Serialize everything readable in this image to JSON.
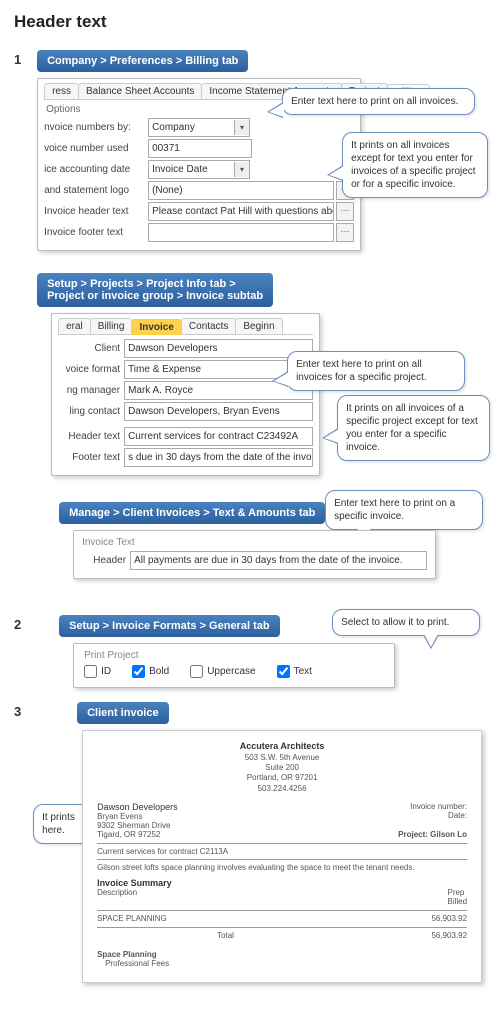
{
  "title": "Header text",
  "steps": [
    "1",
    "2",
    "3"
  ],
  "bc": {
    "billing": "Company > Preferences > Billing  tab",
    "project": "Setup > Projects > Project Info tab >\nProject or invoice group > Invoice subtab",
    "manage": "Manage > Client Invoices > Text & Amounts tab",
    "formats": "Setup > Invoice Formats > General tab",
    "client": "Client invoice"
  },
  "billing": {
    "tabs": [
      "ress",
      "Balance Sheet Accounts",
      "Income Statement Accounts",
      "Project",
      "Billing"
    ],
    "options": "Options",
    "labels": {
      "numby": "nvoice numbers by:",
      "numused": "voice number used",
      "acct": "ice accounting date",
      "logo": "and statement logo",
      "header": "Invoice header text",
      "footer": "Invoice footer text"
    },
    "vals": {
      "numby": "Company",
      "numused": "00371",
      "acct": "Invoice Date",
      "logo": "(None)",
      "header": "Please contact Pat Hill with questions about this invoice.",
      "footer": ""
    }
  },
  "callouts": {
    "c1": "Enter text here to print on all invoices.",
    "c1b": "It prints on all invoices except for text you enter for invoices of a specific project or for a specific invoice.",
    "c2": "Enter text here to print on all invoices for a specific project.",
    "c2b": "It prints on all invoices of a specific project except for text you enter for a specific invoice.",
    "c3": "Enter text here to print on a specific invoice.",
    "c4": "Select to allow it to print.",
    "c5": "It prints here."
  },
  "project": {
    "tabs": [
      "eral",
      "Billing",
      "Invoice",
      "Contacts",
      "Beginn"
    ],
    "labels": {
      "client": "Client",
      "fmt": "voice format",
      "mgr": "ng manager",
      "contact": "ling contact",
      "header": "Header text",
      "footer": "Footer text"
    },
    "vals": {
      "client": "Dawson Developers",
      "fmt": "Time & Expense",
      "mgr": "Mark A. Royce",
      "contact": "Dawson Developers, Bryan Evens",
      "header": "Current services for contract C23492A",
      "footer": "s due in 30 days from the date of the invoi"
    }
  },
  "invtext": {
    "title": "Invoice Text",
    "label": "Header",
    "val": "All payments are due in 30 days from the date of the invoice."
  },
  "formats": {
    "title": "Print Project",
    "id": "ID",
    "bold": "Bold",
    "upper": "Uppercase",
    "text": "Text"
  },
  "invoice": {
    "firm": "Accutera Architects",
    "addr1": "503 S.W. 5th Avenue",
    "addr2": "Suite 200",
    "city": "Portland, OR 97201",
    "phone": "503.224.4256",
    "client": "Dawson Developers",
    "c2": "Bryan Evens",
    "c3": "9302 Sherman Drive",
    "c4": "Tigard, OR 97252",
    "invno": "Invoice number:",
    "date": "Date:",
    "proj": "Project:  Gilson Lo",
    "htext": "Current services for contract C2113A",
    "desc": "Gilson street lofts space planning involves evaluating the space to meet the tenant needs.",
    "summary": "Invoice Summary",
    "dcol": "Description",
    "prep": "Prep",
    "billed": "Billed",
    "sp": "SPACE PLANNING",
    "amt": "56,903.92",
    "total": "Total",
    "sp2": "Space Planning",
    "pf": "Professional Fees"
  }
}
